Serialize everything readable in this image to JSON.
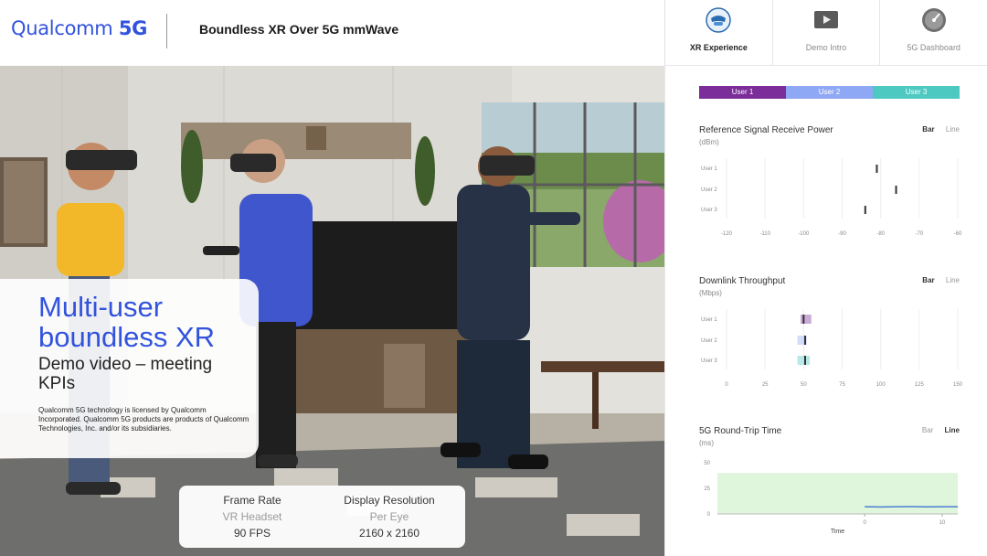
{
  "header": {
    "logo_brand": "Qualcomm",
    "logo_suffix": "5G",
    "title": "Boundless XR Over 5G mmWave"
  },
  "nav_tabs": [
    {
      "label": "XR Experience",
      "icon": "headset-icon",
      "active": true
    },
    {
      "label": "Demo Intro",
      "icon": "play-icon",
      "active": false
    },
    {
      "label": "5G Dashboard",
      "icon": "speedometer-icon",
      "active": false
    }
  ],
  "overlay": {
    "title": "Multi-user boundless XR",
    "subtitle": "Demo video – meeting KPIs",
    "legal": "Qualcomm 5G technology is licensed by Qualcomm Incorporated.  Qualcomm 5G products are products of Qualcomm Technologies, Inc. and/or its subsidiaries."
  },
  "kpis": [
    {
      "label": "Frame Rate",
      "sub": "VR Headset",
      "value": "90 FPS"
    },
    {
      "label": "Display Resolution",
      "sub": "Per Eye",
      "value": "2160 x 2160"
    }
  ],
  "legend": [
    {
      "name": "User 1",
      "color": "#7B2D9A"
    },
    {
      "name": "User 2",
      "color": "#8FA8F5"
    },
    {
      "name": "User 3",
      "color": "#4EC9C2"
    }
  ],
  "panels": [
    {
      "title": "Reference Signal Receive Power",
      "unit": "(dBm)",
      "toggle": [
        "Bar",
        "Line"
      ],
      "active": "Bar"
    },
    {
      "title": "Downlink Throughput",
      "unit": "(Mbps)",
      "toggle": [
        "Bar",
        "Line"
      ],
      "active": "Bar"
    },
    {
      "title": "5G Round-Trip Time",
      "unit": "(ms)",
      "toggle": [
        "Bar",
        "Line"
      ],
      "active": "Line"
    }
  ],
  "chart_data": [
    {
      "type": "bar",
      "title": "Reference Signal Receive Power",
      "ylabel": "(dBm)",
      "categories": [
        "User 1",
        "User 2",
        "User 3"
      ],
      "xticks": [
        "-120",
        "-110",
        "-100",
        "-90",
        "-80",
        "-70",
        "-60"
      ],
      "xlim": [
        -120,
        -60
      ],
      "values": [
        -81,
        -76,
        -84
      ],
      "grid": true
    },
    {
      "type": "bar",
      "title": "Downlink Throughput",
      "ylabel": "(Mbps)",
      "categories": [
        "User 1",
        "User 2",
        "User 3"
      ],
      "xticks": [
        "0",
        "25",
        "50",
        "75",
        "100",
        "125",
        "150"
      ],
      "xlim": [
        0,
        150
      ],
      "ranges": [
        [
          48,
          55
        ],
        [
          46,
          52
        ],
        [
          46,
          54
        ]
      ],
      "values": [
        50,
        51,
        51
      ],
      "grid": true
    },
    {
      "type": "line",
      "title": "5G Round-Trip Time",
      "ylabel": "(ms)",
      "xlabel": "Time",
      "yticks": [
        "50",
        "25",
        "0"
      ],
      "xticks": [
        "0",
        "10"
      ],
      "ylim": [
        0,
        50
      ],
      "xlim": [
        -19,
        12
      ],
      "target_band": [
        0,
        40
      ],
      "series": [
        {
          "x": [
            0,
            2,
            4,
            6,
            8,
            10,
            12
          ],
          "y": [
            7,
            6.8,
            7,
            7.1,
            6.9,
            7,
            7
          ]
        }
      ]
    }
  ]
}
